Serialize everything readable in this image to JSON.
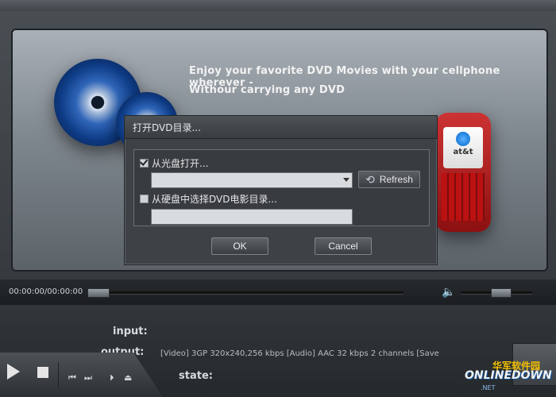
{
  "banner": {
    "line1": "Enjoy your favorite DVD Movies with your cellphone wherever -",
    "line2": "Withour carrying any DVD"
  },
  "phone": {
    "carrier_text": "at&t"
  },
  "dialog": {
    "title": "打开DVD目录...",
    "option_disc": {
      "label": "从光盘打开...",
      "checked": true
    },
    "drive_dropdown": {
      "value": ""
    },
    "refresh_label": "Refresh",
    "option_folder": {
      "label": "从硬盘中选择DVD电影目录...",
      "checked": false
    },
    "folder_path": {
      "value": ""
    },
    "ok_label": "OK",
    "cancel_label": "Cancel"
  },
  "player": {
    "time": "00:00:00/00:00:00",
    "input_label": "input:",
    "output_label": "output:",
    "output_value": "[Video]  3GP 320x240,256 kbps   [Audio]  AAC 32 kbps 2 channels  [Save",
    "state_label": "state:"
  },
  "icons": {
    "play": "play-icon",
    "stop": "stop-icon",
    "prev": "previous-icon",
    "next": "next-icon",
    "step": "step-icon",
    "eject": "eject-icon",
    "volume": "speaker-icon",
    "refresh": "refresh-icon"
  },
  "watermark": {
    "top": "华军软件园",
    "main": "ONLINEDOWN",
    "sub": ".NET"
  }
}
